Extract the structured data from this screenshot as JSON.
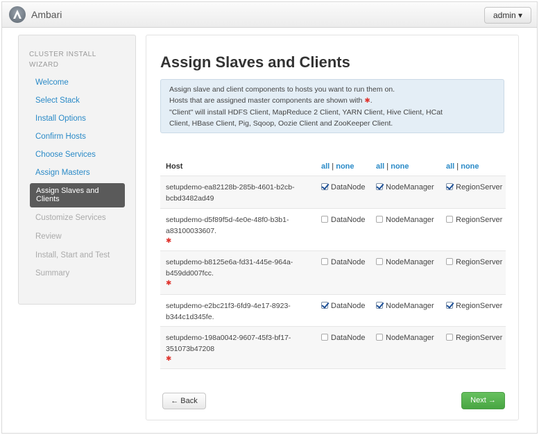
{
  "app": {
    "title": "Ambari",
    "user_menu": "admin ▾"
  },
  "sidebar": {
    "title": "CLUSTER INSTALL WIZARD",
    "items": [
      {
        "label": "Welcome",
        "state": "done"
      },
      {
        "label": "Select Stack",
        "state": "done"
      },
      {
        "label": "Install Options",
        "state": "done"
      },
      {
        "label": "Confirm Hosts",
        "state": "done"
      },
      {
        "label": "Choose Services",
        "state": "done"
      },
      {
        "label": "Assign Masters",
        "state": "done"
      },
      {
        "label": "Assign Slaves and Clients",
        "state": "active"
      },
      {
        "label": "Customize Services",
        "state": "future"
      },
      {
        "label": "Review",
        "state": "future"
      },
      {
        "label": "Install, Start and Test",
        "state": "future"
      },
      {
        "label": "Summary",
        "state": "future"
      }
    ]
  },
  "main": {
    "title": "Assign Slaves and Clients",
    "info_lines": [
      "Assign slave and client components to hosts you want to run them on.",
      "Hosts that are assigned master components are shown with",
      "\"Client\" will install HDFS Client, MapReduce 2 Client, YARN Client, Hive Client, HCat",
      "Client, HBase Client, Pig, Sqoop, Oozie Client and ZooKeeper Client."
    ],
    "required_marker": "✱",
    "table": {
      "host_header": "Host",
      "all_label": "all",
      "separator": "|",
      "none_label": "none",
      "columns": [
        "DataNode",
        "NodeManager",
        "RegionServer"
      ],
      "rows": [
        {
          "host": "setupdemo-ea82128b-285b-4601-b2cb-bcbd3482ad49",
          "master": false,
          "checked": [
            true,
            true,
            true
          ]
        },
        {
          "host": "setupdemo-d5f89f5d-4e0e-48f0-b3b1-a83100033607.",
          "master": true,
          "checked": [
            false,
            false,
            false
          ]
        },
        {
          "host": "setupdemo-b8125e6a-fd31-445e-964a-b459dd007fcc.",
          "master": true,
          "checked": [
            false,
            false,
            false
          ]
        },
        {
          "host": "setupdemo-e2bc21f3-6fd9-4e17-8923-b344c1d345fe.",
          "master": false,
          "checked": [
            true,
            true,
            true
          ]
        },
        {
          "host": "setupdemo-198a0042-9607-45f3-bf17-351073b47208",
          "master": true,
          "checked": [
            false,
            false,
            false
          ]
        }
      ]
    },
    "back_label": "← Back",
    "next_label": "Next →"
  },
  "colors": {
    "link": "#2a8ac7",
    "next_button": "#55b04d",
    "required": "#e0342e",
    "active_nav": "#5a5a5a"
  }
}
